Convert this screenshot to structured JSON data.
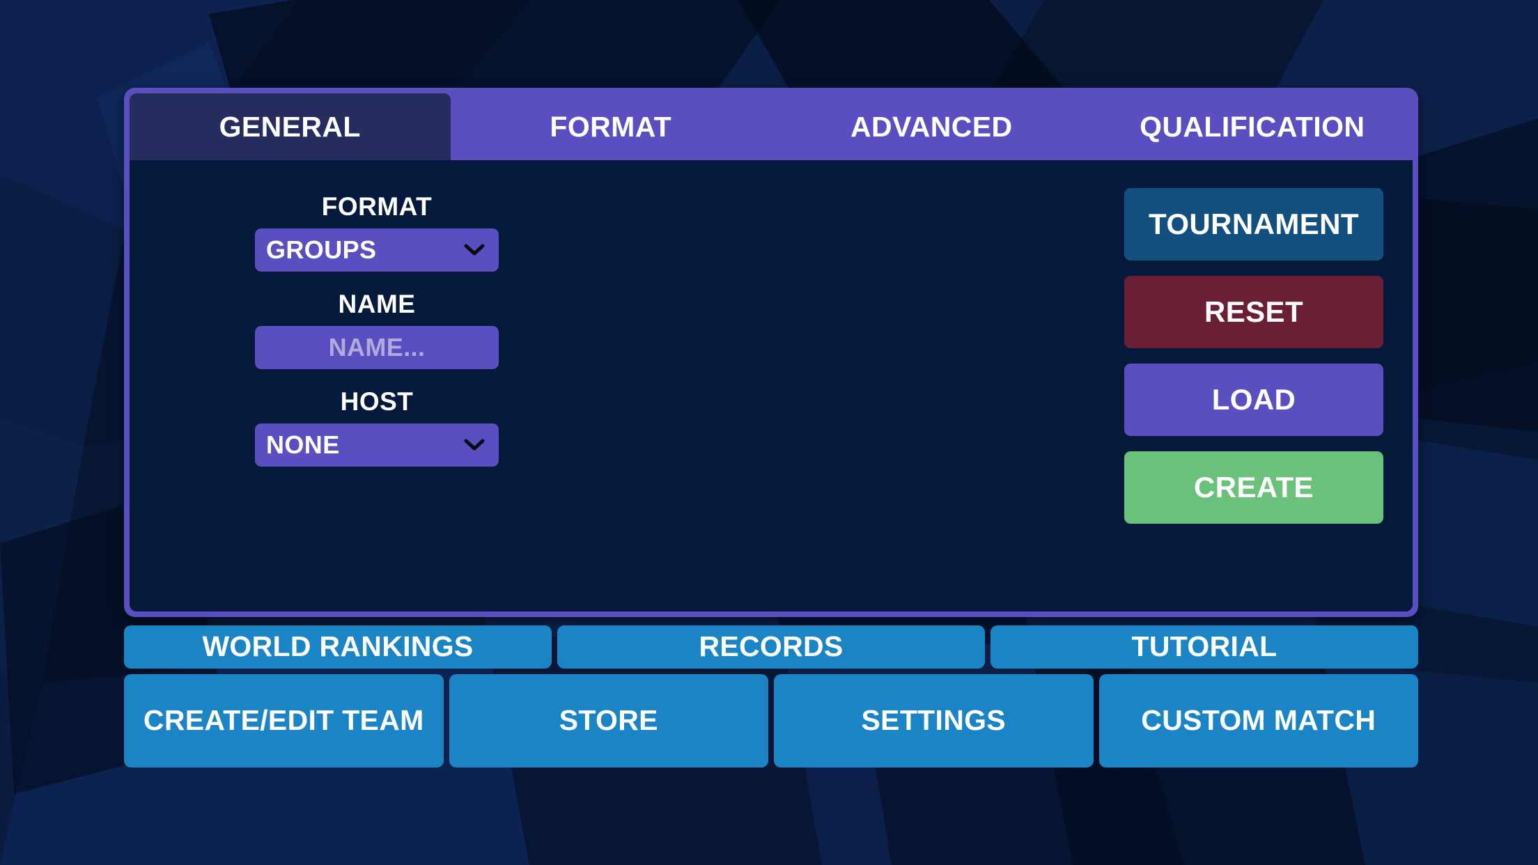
{
  "theme": {
    "panel_border": "#5a4fc0",
    "panel_body": "#05193a",
    "tab_active": "#262c5e",
    "tab_inactive": "#5a4fc0",
    "control_purple": "#5a4fc0",
    "placeholder": "#b0aadd",
    "nav_blue": "#1a84c4",
    "tournament_blue": "#14507f",
    "reset_red": "#6b1f35",
    "load_purple": "#5a4fc0",
    "create_green": "#6ac27a",
    "background": "#071634"
  },
  "tabs": [
    {
      "label": "GENERAL",
      "active": true
    },
    {
      "label": "FORMAT",
      "active": false
    },
    {
      "label": "ADVANCED",
      "active": false
    },
    {
      "label": "QUALIFICATION",
      "active": false
    }
  ],
  "form": {
    "format": {
      "label": "FORMAT",
      "value": "GROUPS",
      "icon": "chevron-down-icon"
    },
    "name": {
      "label": "NAME",
      "value": "",
      "placeholder": "NAME..."
    },
    "host": {
      "label": "HOST",
      "value": "NONE",
      "icon": "chevron-down-icon"
    }
  },
  "actions": [
    {
      "label": "TOURNAMENT",
      "color": "#14507f",
      "name": "tournament-button"
    },
    {
      "label": "RESET",
      "color": "#6b1f35",
      "name": "reset-button"
    },
    {
      "label": "LOAD",
      "color": "#5a4fc0",
      "name": "load-button"
    },
    {
      "label": "CREATE",
      "color": "#6ac27a",
      "name": "create-button"
    }
  ],
  "bottom_nav": {
    "row1": [
      {
        "label": "WORLD RANKINGS",
        "flex": 440
      },
      {
        "label": "RECORDS",
        "flex": 440
      },
      {
        "label": "TUTORIAL",
        "flex": 440
      }
    ],
    "row2": [
      {
        "label": "CREATE/EDIT TEAM",
        "flex": 330
      },
      {
        "label": "STORE",
        "flex": 330
      },
      {
        "label": "SETTINGS",
        "flex": 330
      },
      {
        "label": "CUSTOM MATCH",
        "flex": 330
      }
    ]
  }
}
